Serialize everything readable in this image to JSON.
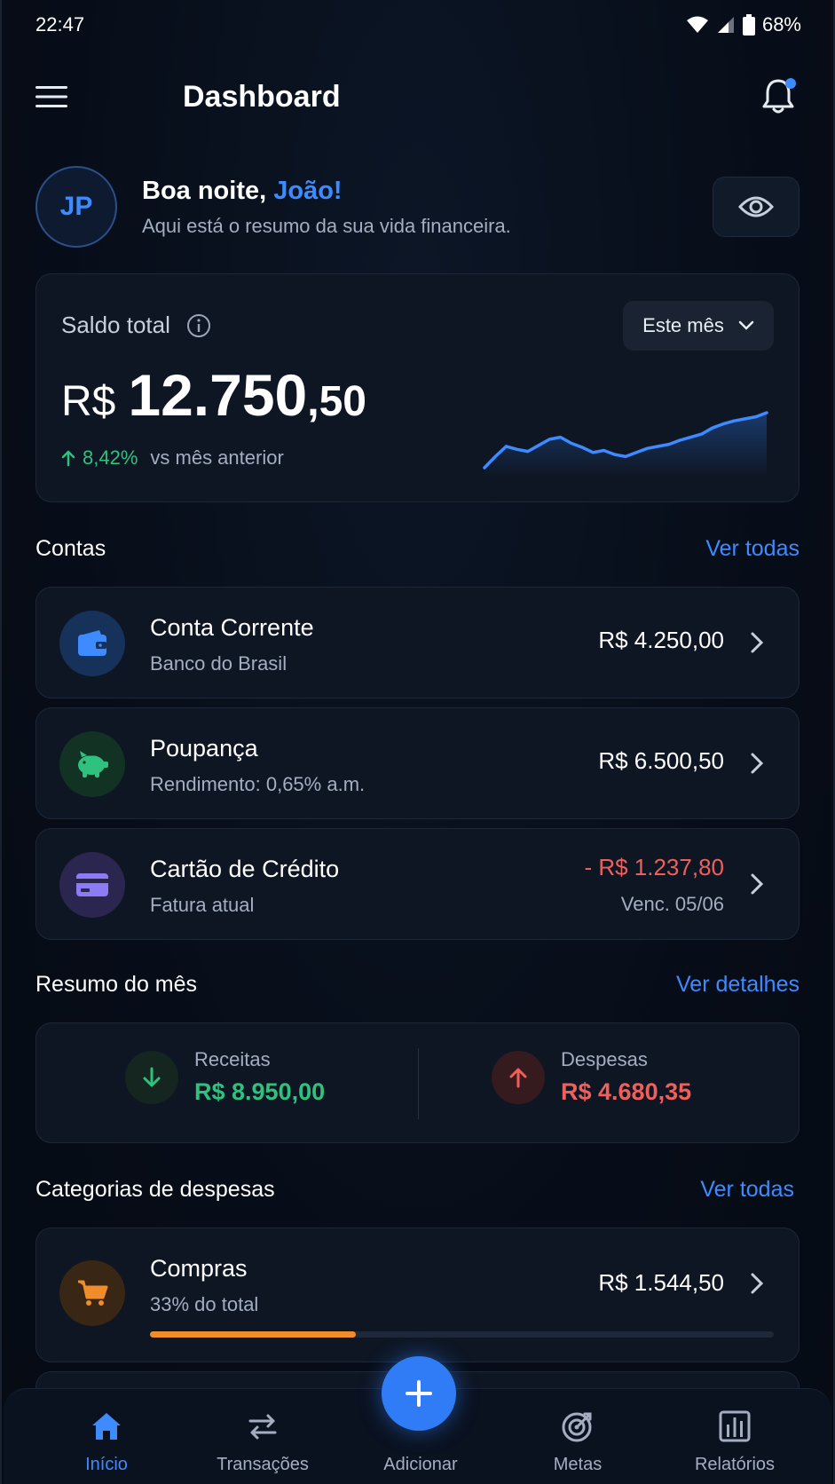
{
  "status_bar": {
    "time": "22:47",
    "battery": "68%"
  },
  "app_bar": {
    "title": "Dashboard"
  },
  "greeting": {
    "avatar_initials": "JP",
    "hello": "Boa noite, ",
    "name": "João!",
    "subtitle": "Aqui está o resumo da sua vida financeira."
  },
  "balance": {
    "label": "Saldo total",
    "period": "Este mês",
    "currency": "R$",
    "integer": "12.750",
    "decimal": ",50",
    "change": "8,42%",
    "change_label": "vs mês anterior",
    "trend": [
      3,
      14,
      24,
      21,
      19,
      25,
      31,
      33,
      27,
      23,
      18,
      20,
      16,
      14,
      18,
      22,
      24,
      26,
      30,
      33,
      36,
      42,
      46,
      49,
      51,
      53,
      57
    ]
  },
  "accounts": {
    "title": "Contas",
    "link": "Ver todas",
    "items": [
      {
        "name": "Conta Corrente",
        "sub": "Banco do Brasil",
        "value": "R$ 4.250,00",
        "icon": "wallet-icon",
        "color": "#3d8bff"
      },
      {
        "name": "Poupança",
        "sub": "Rendimento: 0,65% a.m.",
        "value": "R$ 6.500,50",
        "icon": "piggy-bank-icon",
        "color": "#2ec27e"
      },
      {
        "name": "Cartão de Crédito",
        "sub": "Fatura atual",
        "value": "- R$ 1.237,80",
        "value2": "Venc. 05/06",
        "icon": "credit-card-icon",
        "color": "#8b7cf6"
      }
    ]
  },
  "summary": {
    "title": "Resumo do mês",
    "link": "Ver detalhes",
    "income_label": "Receitas",
    "income_value": "R$ 8.950,00",
    "expense_label": "Despesas",
    "expense_value": "R$ 4.680,35"
  },
  "categories": {
    "title": "Categorias de despesas",
    "link": "Ver todas",
    "items": [
      {
        "name": "Compras",
        "sub": "33% do total",
        "value": "R$ 1.544,50",
        "progress": 0.33,
        "icon": "shopping-cart-icon",
        "color": "#f08c2a"
      }
    ]
  },
  "nav": {
    "items": [
      "Início",
      "Transações",
      "Adicionar",
      "Metas",
      "Relatórios"
    ],
    "active": "Início"
  },
  "colors": {
    "accent": "#3d8bff",
    "positive": "#2ec27e",
    "negative": "#f0605b",
    "orange": "#f08c2a"
  }
}
